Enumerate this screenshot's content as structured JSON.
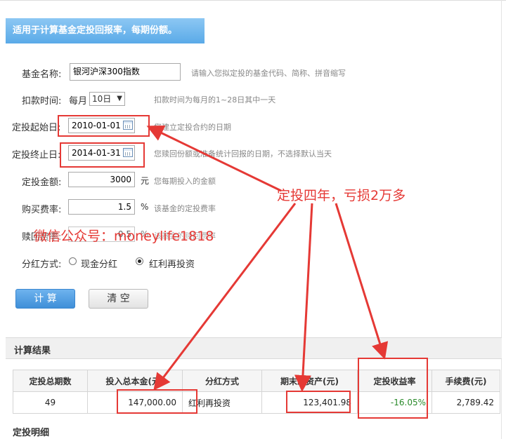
{
  "banner": {
    "text": "适用于计算基金定投回报率，每期份额。"
  },
  "form": {
    "fund_name": {
      "label": "基金名称:",
      "value": "银河沪深300指数",
      "hint": "请输入您拟定投的基金代码、简称、拼音缩写"
    },
    "deduct_time": {
      "label": "扣款时间:",
      "prefix": "每月",
      "selected": "10日",
      "hint": "扣款时间为每月的1~28日其中一天"
    },
    "start_date": {
      "label": "定投起始日:",
      "value": "2010-01-01",
      "hint": "您建立定投合约的日期"
    },
    "end_date": {
      "label": "定投终止日:",
      "value": "2014-01-31",
      "hint": "您赎回份额或准备统计回报的日期，不选择默认当天"
    },
    "amount": {
      "label": "定投金额:",
      "value": "3000",
      "unit": "元",
      "hint": "您每期投入的金额"
    },
    "buy_fee": {
      "label": "购买费率:",
      "value": "1.5",
      "unit": "%",
      "hint": "该基金的定投费率"
    },
    "redeem_fee": {
      "label": "赎回费率:",
      "value": "0.5",
      "unit": "%",
      "hint": "该基金的赎回费率"
    },
    "dividend": {
      "label": "分红方式:",
      "option_cash": "现金分红",
      "option_reinvest": "红利再投资",
      "selected": "红利再投资"
    }
  },
  "buttons": {
    "calculate": "计 算",
    "clear": "清 空"
  },
  "results": {
    "title": "计算结果",
    "columns": [
      "定投总期数",
      "投入总本金(元)",
      "分红方式",
      "期末总资产(元)",
      "定投收益率",
      "手续费(元)"
    ],
    "row": [
      "49",
      "147,000.00",
      "红利再投资",
      "123,401.98",
      "-16.05%",
      "2,789.42"
    ]
  },
  "detail": {
    "title": "定投明细"
  },
  "annotation": {
    "text": "定投四年，亏损2万多"
  },
  "watermark": {
    "text": "微信公众号：moneylife1818"
  },
  "colors": {
    "accent": "#4a9be3",
    "annotation_red": "#e53935",
    "negative_green": "#2a8a2a"
  },
  "icons": {
    "calendar": "calendar-icon",
    "select_arrow": "chevron-down-icon"
  }
}
